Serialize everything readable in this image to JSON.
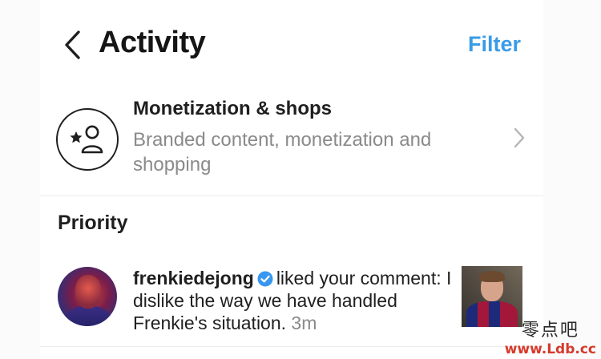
{
  "header": {
    "title": "Activity",
    "filter_label": "Filter"
  },
  "monetization": {
    "title": "Monetization & shops",
    "subtitle": "Branded content, monetization and shopping"
  },
  "sections": {
    "priority_title": "Priority"
  },
  "notification": {
    "username": "frenkiedejong",
    "text": "liked your comment: I dislike the way we have handled Frenkie's situation.",
    "time": "3m"
  },
  "watermark": {
    "chinese": "零点吧",
    "url": "www.Ldb.cc"
  },
  "colors": {
    "accent": "#3a9be6",
    "verified": "#3897f0",
    "secondary_text": "#8a8a8a"
  },
  "icons": {
    "back": "chevron-left-icon",
    "monetization": "star-person-icon",
    "row_chevron": "chevron-right-icon",
    "verified": "verified-badge-icon"
  }
}
